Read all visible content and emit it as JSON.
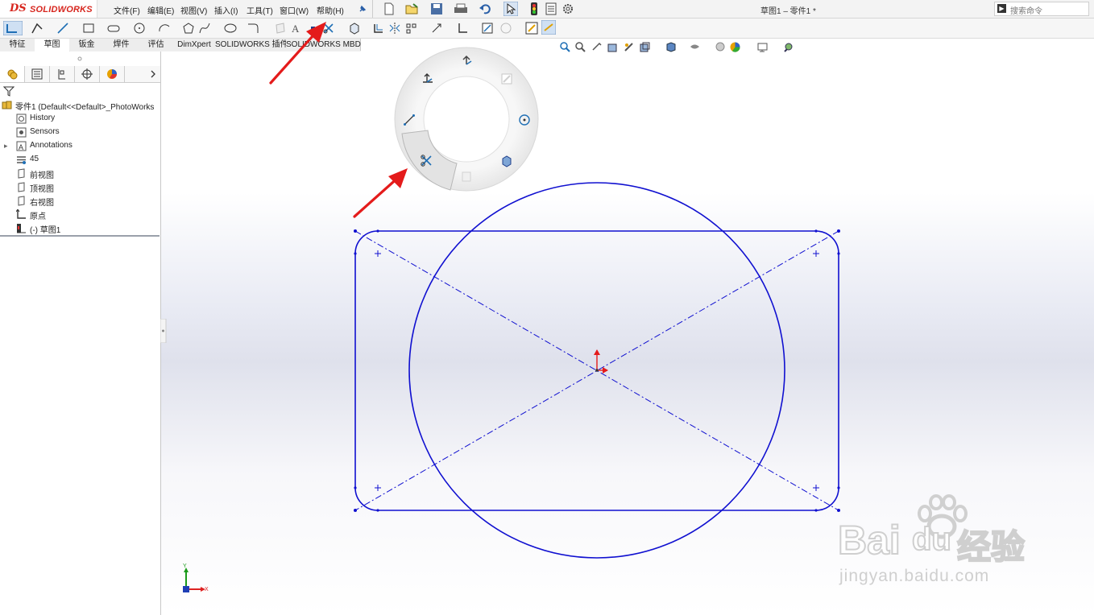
{
  "app": {
    "logo_ds": "DS",
    "logo_text": "SOLIDWORKS",
    "document_title": "草图1 – 零件1 *"
  },
  "menu": [
    {
      "label": "文件(F)"
    },
    {
      "label": "编辑(E)"
    },
    {
      "label": "视图(V)"
    },
    {
      "label": "插入(I)"
    },
    {
      "label": "工具(T)"
    },
    {
      "label": "窗口(W)"
    },
    {
      "label": "帮助(H)"
    }
  ],
  "search": {
    "placeholder": "搜索命令"
  },
  "command_tabs": [
    {
      "label": "特征"
    },
    {
      "label": "草图"
    },
    {
      "label": "钣金"
    },
    {
      "label": "焊件"
    },
    {
      "label": "评估"
    },
    {
      "label": "DimXpert"
    },
    {
      "label": "SOLIDWORKS 插件"
    },
    {
      "label": "SOLIDWORKS MBD"
    }
  ],
  "active_tab": "草图",
  "feature_tree": [
    {
      "label": "零件1  (Default<<Default>_PhotoWorks",
      "icon": "part-icon"
    },
    {
      "label": "History",
      "icon": "history-icon"
    },
    {
      "label": "Sensors",
      "icon": "sensors-icon"
    },
    {
      "label": "Annotations",
      "icon": "annotations-icon"
    },
    {
      "label": "45",
      "icon": "material-icon"
    },
    {
      "label": "前视图",
      "icon": "plane-icon"
    },
    {
      "label": "顶视图",
      "icon": "plane-icon"
    },
    {
      "label": "右视图",
      "icon": "plane-icon"
    },
    {
      "label": "原点",
      "icon": "origin-icon"
    },
    {
      "label": "(-) 草图1",
      "icon": "sketch-icon"
    }
  ],
  "triad": {
    "y_label": "Y",
    "x_label": "X"
  },
  "watermark": {
    "brand": "Bai",
    "brand2": "du",
    "suffix": "经验",
    "url": "jingyan.baidu.com"
  },
  "colors": {
    "sketch_blue": "#1010d0",
    "arrow_red": "#e41b1b",
    "accent": "#1f6fb5"
  }
}
